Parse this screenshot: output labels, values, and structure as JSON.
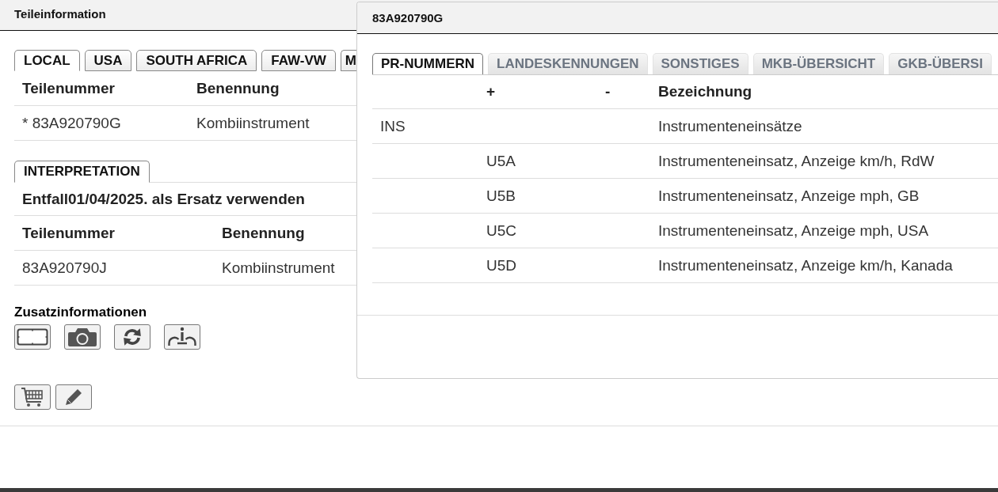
{
  "page": {
    "title": "Teileinformation"
  },
  "market_tabs": [
    {
      "label": "LOCAL",
      "selected": true
    },
    {
      "label": "USA",
      "selected": false
    },
    {
      "label": "SOUTH AFRICA",
      "selected": false
    },
    {
      "label": "FAW-VW",
      "selected": false
    },
    {
      "label": "M",
      "selected": false
    }
  ],
  "parts_table": {
    "columns": [
      "Teilenummer",
      "Benennung"
    ],
    "rows": [
      [
        "* 83A920790G",
        "Kombiinstrument"
      ]
    ]
  },
  "interpretation": {
    "tab": {
      "label": "INTERPRETATION",
      "selected": true
    },
    "note": "Entfall01/04/2025. als Ersatz verwenden",
    "columns": [
      "Teilenummer",
      "Benennung"
    ],
    "rows": [
      [
        "83A920790J",
        "Kombiinstrument"
      ]
    ]
  },
  "additional_info": {
    "title": "Zusatzinformationen"
  },
  "dialog": {
    "title": "83A920790G",
    "tabs": [
      {
        "label": "PR-NUMMERN",
        "selected": true
      },
      {
        "label": "LANDESKENNUNGEN",
        "selected": false
      },
      {
        "label": "SONSTIGES",
        "selected": false
      },
      {
        "label": "MKB-ÜBERSICHT",
        "selected": false
      },
      {
        "label": "GKB-ÜBERSI",
        "selected": false
      }
    ],
    "table": {
      "header": {
        "plus": "+",
        "minus": "-",
        "description": "Bezeichnung"
      },
      "rows": [
        {
          "column_1": "INS",
          "description": "Instrumenteneinsätze"
        },
        {
          "plus": "U5A",
          "description": "Instrumenteneinsatz, Anzeige km/h, RdW"
        },
        {
          "plus": "U5B",
          "description": "Instrumenteneinsatz, Anzeige mph, GB"
        },
        {
          "plus": "U5C",
          "description": "Instrumenteneinsatz, Anzeige mph, USA"
        },
        {
          "plus": "U5D",
          "description": "Instrumenteneinsatz, Anzeige km/h, Kanada"
        }
      ]
    }
  }
}
